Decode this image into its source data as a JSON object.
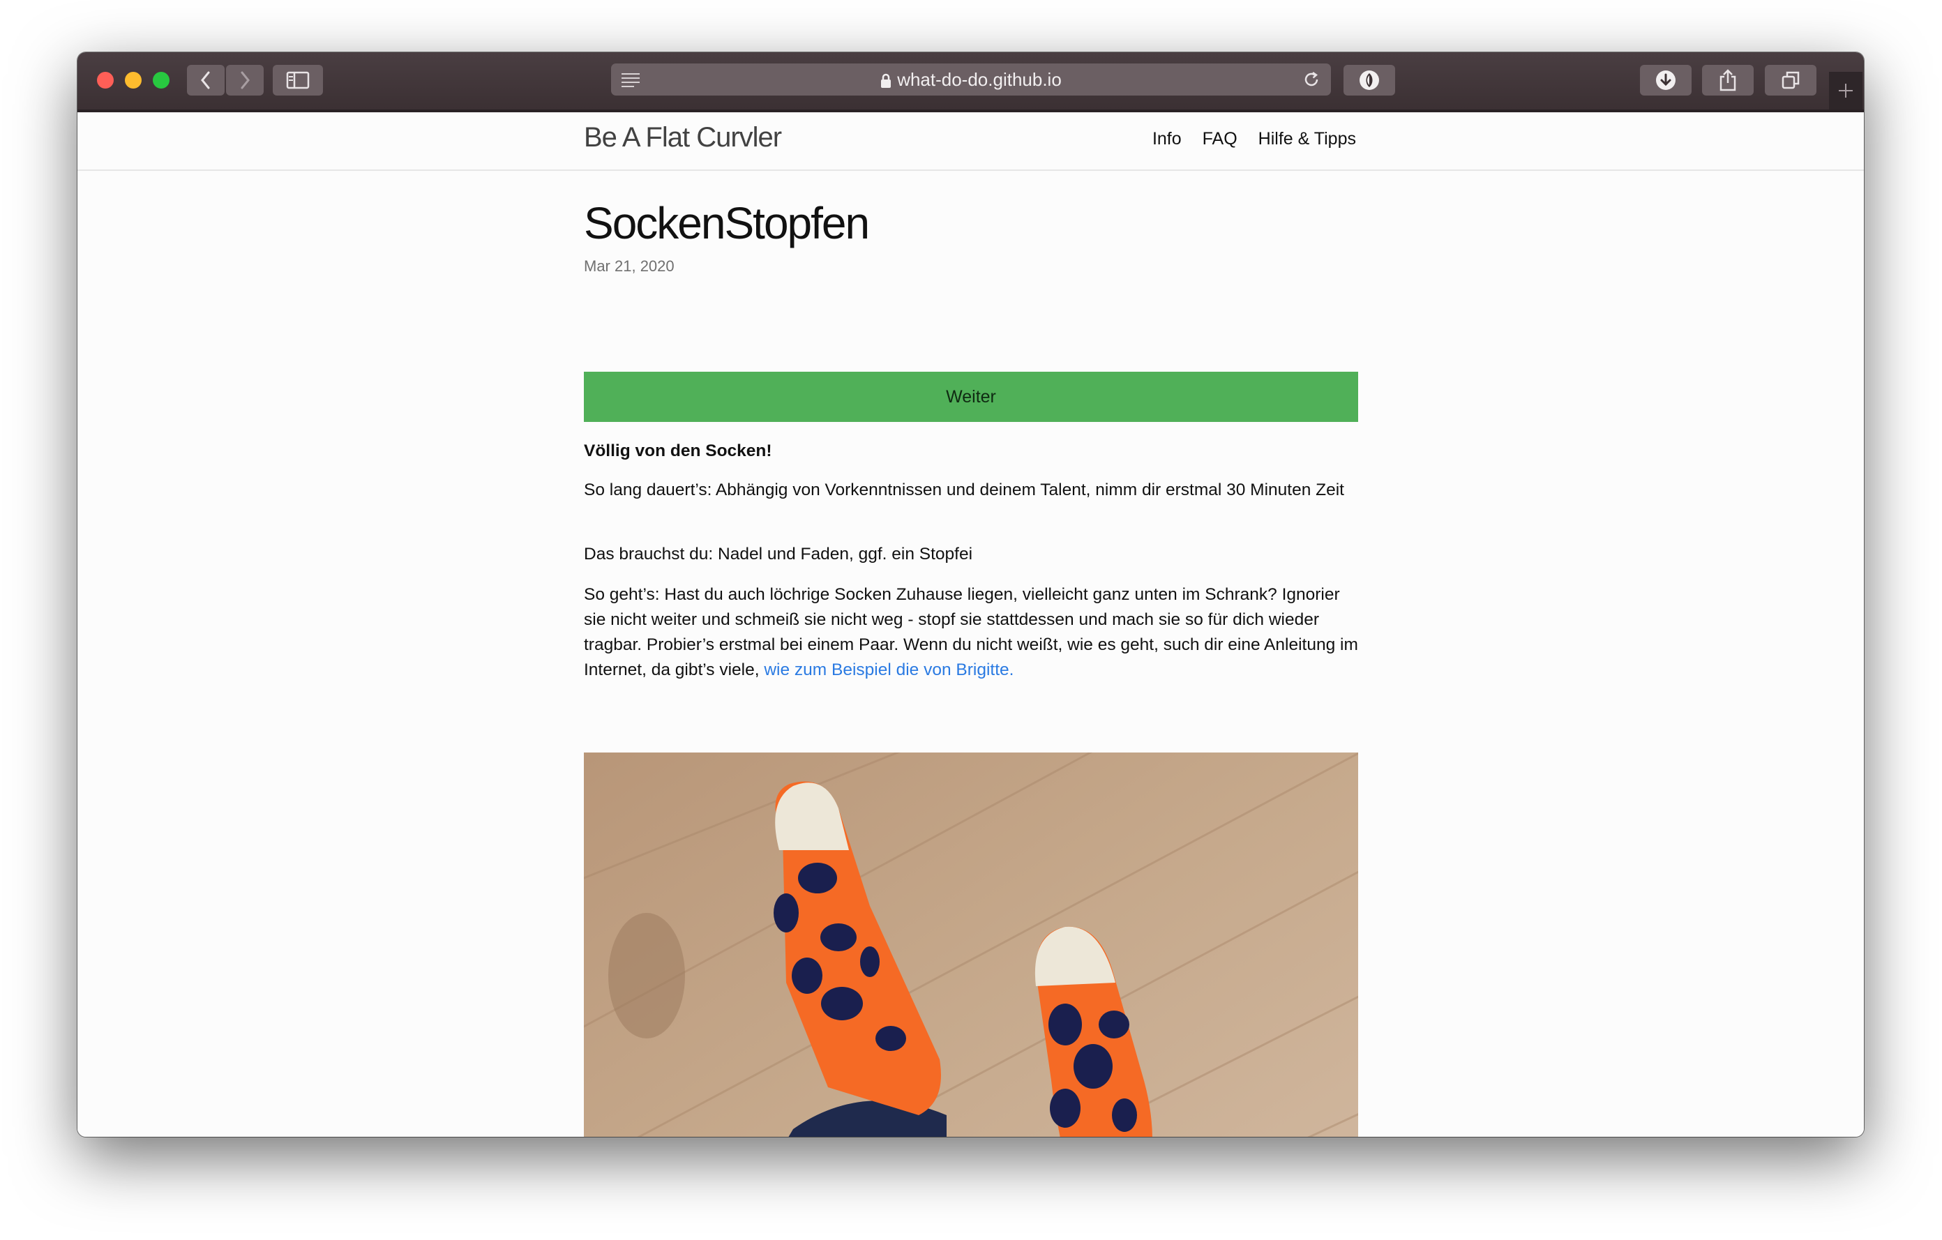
{
  "browser": {
    "url": "what-do-do.github.io"
  },
  "site": {
    "title": "Be A Flat Curvler",
    "nav": [
      "Info",
      "FAQ",
      "Hilfe & Tipps"
    ]
  },
  "post": {
    "title": "SockenStopfen",
    "date": "Mar 21, 2020",
    "button_label": "Weiter",
    "heading": "Völlig von den Socken!",
    "duration": "So lang dauert’s: Abhängig von Vorkenntnissen und deinem Talent, nimm dir erstmal 30 Minuten Zeit",
    "materials": "Das brauchst du: Nadel und Faden, ggf. ein Stopfei",
    "howto_text": "So geht’s: Hast du auch löchrige Socken Zuhause liegen, vielleicht ganz unten im Schrank? Ignorier sie nicht weiter und schmeiß sie nicht weg - stopf sie stattdessen und mach sie so für dich wieder tragbar. Probier’s erstmal bei einem Paar. Wenn du nicht weißt, wie es geht, such dir eine Anleitung im Internet, da gibt’s viele,",
    "howto_link": "wie zum Beispiel die von Brigitte."
  },
  "colors": {
    "accent_button": "#50b058",
    "link": "#2a7ae2",
    "sock_orange": "#f56a25",
    "sock_dots": "#1a1f4e"
  },
  "icons": [
    "back-icon",
    "forward-icon",
    "sidebar-icon",
    "reader-icon",
    "lock-icon",
    "reload-icon",
    "extension-icon",
    "download-icon",
    "share-icon",
    "tabs-icon",
    "new-tab-icon"
  ]
}
